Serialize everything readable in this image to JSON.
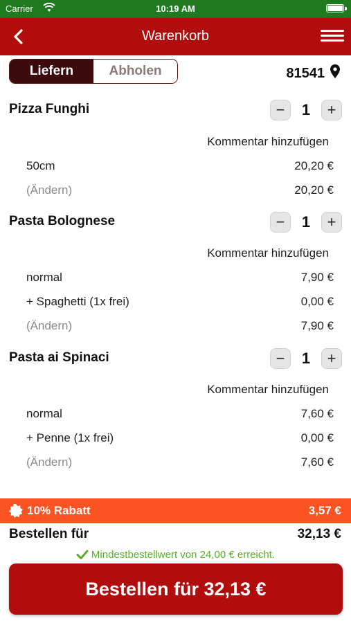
{
  "status_bar": {
    "carrier": "Carrier",
    "time": "10:19 AM"
  },
  "header": {
    "title": "Warenkorb"
  },
  "delivery_toggle": {
    "option_1": "Liefern",
    "option_2": "Abholen",
    "selected": "Liefern"
  },
  "location": {
    "zip": "81541"
  },
  "items": [
    {
      "name": "Pizza Funghi",
      "qty": "1",
      "comment_label": "Kommentar hinzufügen",
      "lines": [
        {
          "label": "50cm",
          "price": "20,20 €"
        }
      ],
      "change_label": "(Ändern)",
      "subtotal": "20,20 €"
    },
    {
      "name": "Pasta Bolognese",
      "qty": "1",
      "comment_label": "Kommentar hinzufügen",
      "lines": [
        {
          "label": "normal",
          "price": "7,90 €"
        },
        {
          "label": "+ Spaghetti (1x frei)",
          "price": "0,00 €"
        }
      ],
      "change_label": "(Ändern)",
      "subtotal": "7,90 €"
    },
    {
      "name": "Pasta ai Spinaci",
      "qty": "1",
      "comment_label": "Kommentar hinzufügen",
      "lines": [
        {
          "label": "normal",
          "price": "7,60 €"
        },
        {
          "label": "+ Penne (1x frei)",
          "price": "0,00 €"
        }
      ],
      "change_label": "(Ändern)",
      "subtotal": "7,60 €"
    }
  ],
  "stepper": {
    "minus": "−",
    "plus": "+"
  },
  "discount": {
    "label": "10% Rabatt",
    "value": "3,57 €"
  },
  "total": {
    "label": "Bestellen für",
    "value": "32,13 €"
  },
  "min_order_message": "Mindestbestellwert von 24,00 € erreicht.",
  "order_button_label": "Bestellen für 32,13 €",
  "colors": {
    "header": "#b20d0d",
    "status_bar": "#1f7a1f",
    "discount": "#fb5422",
    "success": "#5aae2a",
    "toggle_active": "#3c0a0a"
  },
  "icons": [
    "wifi-icon",
    "battery-icon",
    "back-chevron-icon",
    "hamburger-menu-icon",
    "location-pin-icon",
    "discount-badge-icon",
    "checkmark-icon"
  ]
}
